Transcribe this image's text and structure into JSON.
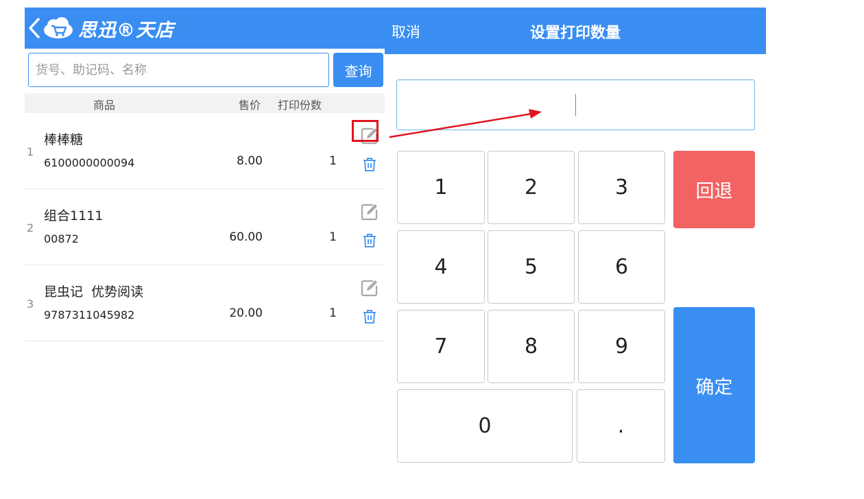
{
  "app": {
    "logo_text": "思迅®天店"
  },
  "search": {
    "placeholder": "货号、助记码、名称",
    "value": "",
    "button_label": "查询"
  },
  "table": {
    "columns": [
      "商品",
      "售价",
      "打印份数"
    ],
    "rows": [
      {
        "index": "1",
        "name": "棒棒糖",
        "code": "6100000000094",
        "price": "8.00",
        "copies": "1"
      },
      {
        "index": "2",
        "name": "组合1111",
        "code": "00872",
        "price": "60.00",
        "copies": "1"
      },
      {
        "index": "3",
        "name": "昆虫记  优势阅读",
        "code": "9787311045982",
        "price": "20.00",
        "copies": "1"
      }
    ]
  },
  "dialog": {
    "cancel_label": "取消",
    "title": "设置打印数量",
    "input_value": "",
    "keys": [
      "1",
      "2",
      "3",
      "4",
      "5",
      "6",
      "7",
      "8",
      "9",
      "0",
      "."
    ],
    "backspace_label": "回退",
    "confirm_label": "确定"
  },
  "icons": {
    "back": "chevron-left-icon",
    "logo": "cloud-cart-icon",
    "edit": "edit-icon",
    "delete": "trash-icon"
  },
  "colors": {
    "primary": "#3a8ef2",
    "danger": "#f26363",
    "highlight": "#e0141e"
  }
}
